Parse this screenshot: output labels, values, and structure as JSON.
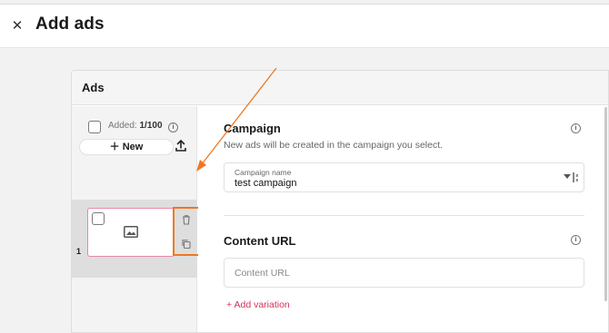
{
  "header": {
    "close_icon": "close-icon",
    "title": "Add ads"
  },
  "panel": {
    "title": "Ads"
  },
  "sidebar": {
    "added_label": "Added:",
    "added_count": "1/100",
    "new_button": "New",
    "ads": [
      {
        "index": "1"
      }
    ]
  },
  "campaign": {
    "title": "Campaign",
    "description": "New ads will be created in the campaign you select.",
    "field_label": "Campaign name",
    "field_value": "test campaign"
  },
  "content_url": {
    "title": "Content URL",
    "placeholder": "Content URL",
    "add_variation": "Add variation"
  },
  "colors": {
    "accent": "#d6325a",
    "highlight": "#f07722",
    "card_border": "#e58aa7"
  }
}
